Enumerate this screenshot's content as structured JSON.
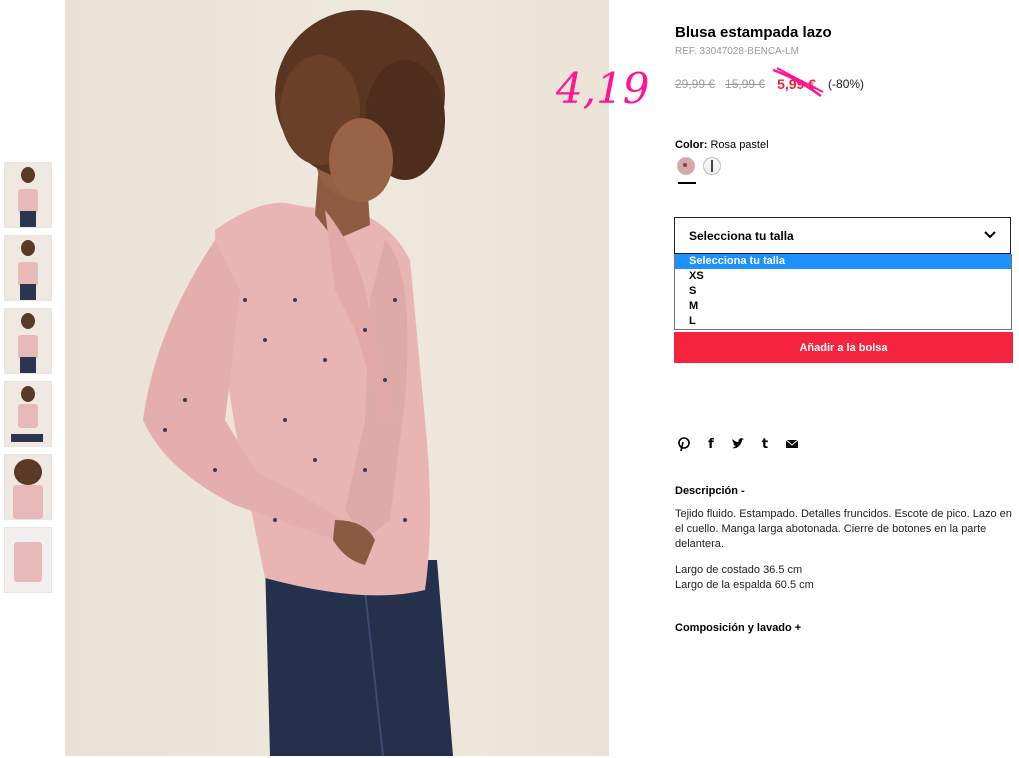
{
  "thumbnails": [
    "Vista frontal",
    "Vista completa",
    "Vista espalda",
    "Vista sentada",
    "Detalle",
    "Prenda"
  ],
  "product": {
    "title": "Blusa estampada lazo",
    "ref": "REF. 33047028-BENCA-LM",
    "prices": {
      "original": "29,99 €",
      "previous": "15,99 €",
      "sale": "5,99 €",
      "discount": "(-80%)"
    },
    "handwritten_price": "4,19",
    "color": {
      "label": "Color:",
      "value": "Rosa pastel",
      "swatches": [
        {
          "name": "rosa",
          "color": "#d9a6a6"
        },
        {
          "name": "blanco",
          "color": "#f4f4f4"
        }
      ]
    }
  },
  "size": {
    "placeholder": "Selecciona tu talla",
    "options": [
      "Selecciona tu talla",
      "XS",
      "S",
      "M",
      "L"
    ]
  },
  "cart": {
    "button_label": "Añadir a la bolsa"
  },
  "share": [
    "pinterest-icon",
    "facebook-icon",
    "twitter-icon",
    "tumblr-icon",
    "mail-icon"
  ],
  "description": {
    "heading": "Descripción -",
    "text": "Tejido fluido. Estampado. Detalles fruncidos. Escote de pico. Lazo en el cuello. Manga larga abotonada. Cierre de botones en la parte delantera.",
    "measure1": "Largo de costado 36.5 cm",
    "measure2": "Largo de la espalda 60.5 cm"
  },
  "composition": {
    "heading": "Composición y lavado +"
  },
  "colors": {
    "sale_red": "#e5233f",
    "button_red": "#f5233d",
    "handwriting": "#ff1493",
    "highlight": "#1e90ff"
  }
}
